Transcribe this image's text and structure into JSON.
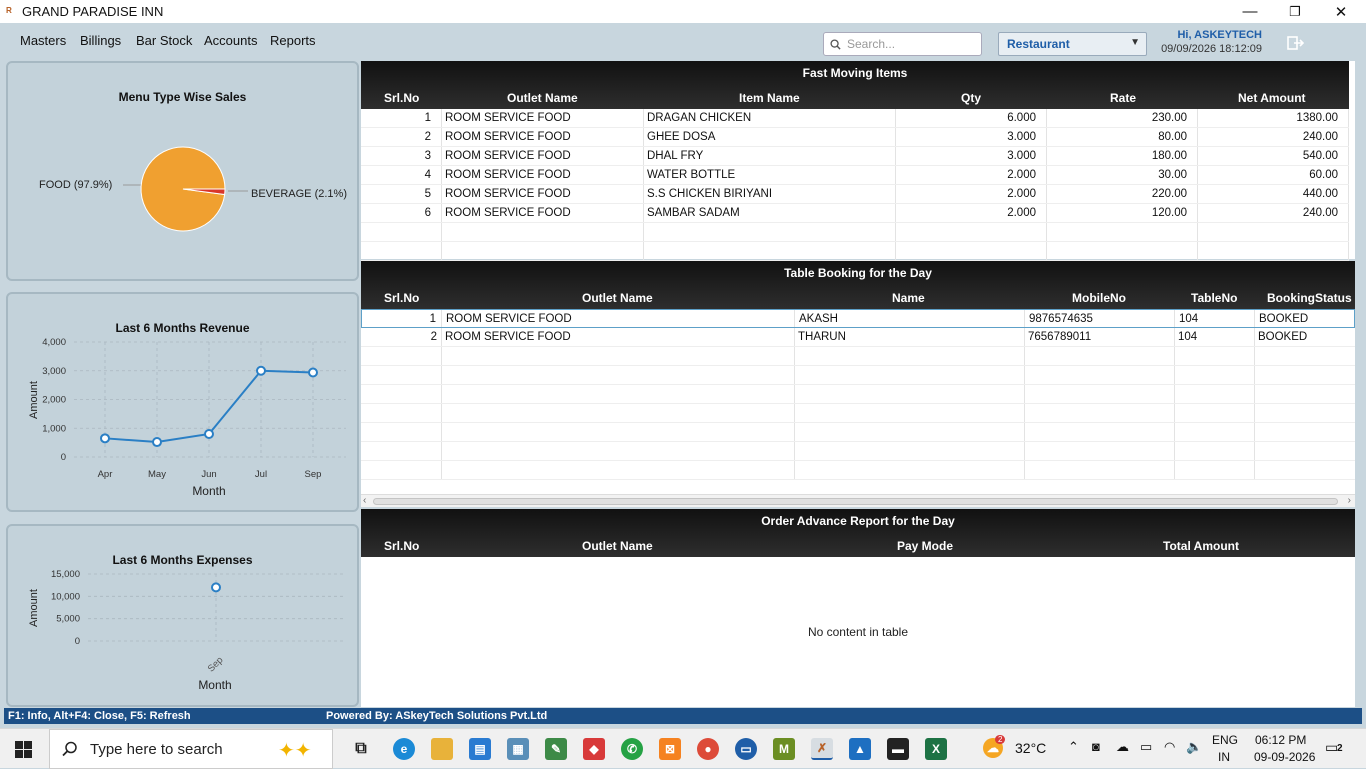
{
  "window": {
    "title": "GRAND PARADISE INN",
    "minimize": "—",
    "maximize": "❐",
    "close": "✕"
  },
  "menu": {
    "items": [
      "Masters",
      "Billings",
      "Bar Stock",
      "Accounts",
      "Reports"
    ]
  },
  "search": {
    "placeholder": "Search..."
  },
  "outlet": {
    "selected": "Restaurant"
  },
  "user": {
    "greeting": "Hi, ASKEYTECH",
    "datetime": "09/09/2026 18:12:09"
  },
  "menu_type_sales": {
    "title": "Menu Type Wise Sales",
    "label_food": "FOOD (97.9%)",
    "label_beverage": "BEVERAGE (2.1%)"
  },
  "revenue_chart": {
    "title": "Last 6 Months Revenue",
    "ylabel": "Amount",
    "xlabel": "Month",
    "yticks": [
      "4,000",
      "3,000",
      "2,000",
      "1,000",
      "0"
    ],
    "xticks": [
      "Apr",
      "May",
      "Jun",
      "Jul",
      "Sep"
    ]
  },
  "expenses_chart": {
    "title": "Last 6 Months Expenses",
    "ylabel": "Amount",
    "xlabel": "Month",
    "yticks": [
      "15,000",
      "10,000",
      "5,000",
      "0"
    ],
    "xticks": [
      "Sep"
    ]
  },
  "chart_data": [
    {
      "type": "pie",
      "title": "Menu Type Wise Sales",
      "categories": [
        "FOOD",
        "BEVERAGE"
      ],
      "values": [
        97.9,
        2.1
      ],
      "colors": [
        "#f0a030",
        "#d9362a"
      ]
    },
    {
      "type": "line",
      "title": "Last 6 Months Revenue",
      "xlabel": "Month",
      "ylabel": "Amount",
      "categories": [
        "Apr",
        "May",
        "Jun",
        "Jul",
        "Sep"
      ],
      "values": [
        650,
        520,
        800,
        3000,
        2940
      ],
      "ylim": [
        0,
        4000
      ]
    },
    {
      "type": "scatter",
      "title": "Last 6 Months Expenses",
      "xlabel": "Month",
      "ylabel": "Amount",
      "categories": [
        "Sep"
      ],
      "values": [
        12000
      ],
      "ylim": [
        0,
        15000
      ]
    }
  ],
  "fast_moving": {
    "title": "Fast Moving Items",
    "columns": [
      "Srl.No",
      "Outlet Name",
      "Item Name",
      "Qty",
      "Rate",
      "Net Amount"
    ],
    "rows": [
      [
        "1",
        "ROOM SERVICE FOOD",
        "DRAGAN CHICKEN",
        "6.000",
        "230.00",
        "1380.00"
      ],
      [
        "2",
        "ROOM SERVICE FOOD",
        "GHEE DOSA",
        "3.000",
        "80.00",
        "240.00"
      ],
      [
        "3",
        "ROOM SERVICE FOOD",
        "DHAL FRY",
        "3.000",
        "180.00",
        "540.00"
      ],
      [
        "4",
        "ROOM SERVICE FOOD",
        "WATER BOTTLE",
        "2.000",
        "30.00",
        "60.00"
      ],
      [
        "5",
        "ROOM SERVICE FOOD",
        "S.S  CHICKEN BIRIYANI",
        "2.000",
        "220.00",
        "440.00"
      ],
      [
        "6",
        "ROOM SERVICE FOOD",
        "SAMBAR SADAM",
        "2.000",
        "120.00",
        "240.00"
      ]
    ]
  },
  "table_booking": {
    "title": "Table Booking for the Day",
    "columns": [
      "Srl.No",
      "Outlet Name",
      "Name",
      "MobileNo",
      "TableNo",
      "BookingStatus"
    ],
    "rows": [
      [
        "1",
        "ROOM SERVICE FOOD",
        "AKASH",
        "9876574635",
        "104",
        "BOOKED"
      ],
      [
        "2",
        "ROOM SERVICE FOOD",
        "THARUN",
        "7656789011",
        "104",
        "BOOKED"
      ]
    ]
  },
  "order_advance": {
    "title": "Order Advance Report for the Day",
    "columns": [
      "Srl.No",
      "Outlet Name",
      "Pay Mode",
      "Total Amount"
    ],
    "empty_text": "No content in table"
  },
  "status_bar": {
    "shortcuts": "F1: Info, Alt+F4: Close, F5: Refresh",
    "powered": "Powered By: ASkeyTech Solutions Pvt.Ltd"
  },
  "taskbar": {
    "search_placeholder": "Type here to search",
    "weather": "32°C",
    "lang": "ENG",
    "region": "IN",
    "time": "06:12 PM",
    "date": "09-09-2026",
    "notifications": "2",
    "weather_badge": "2"
  }
}
